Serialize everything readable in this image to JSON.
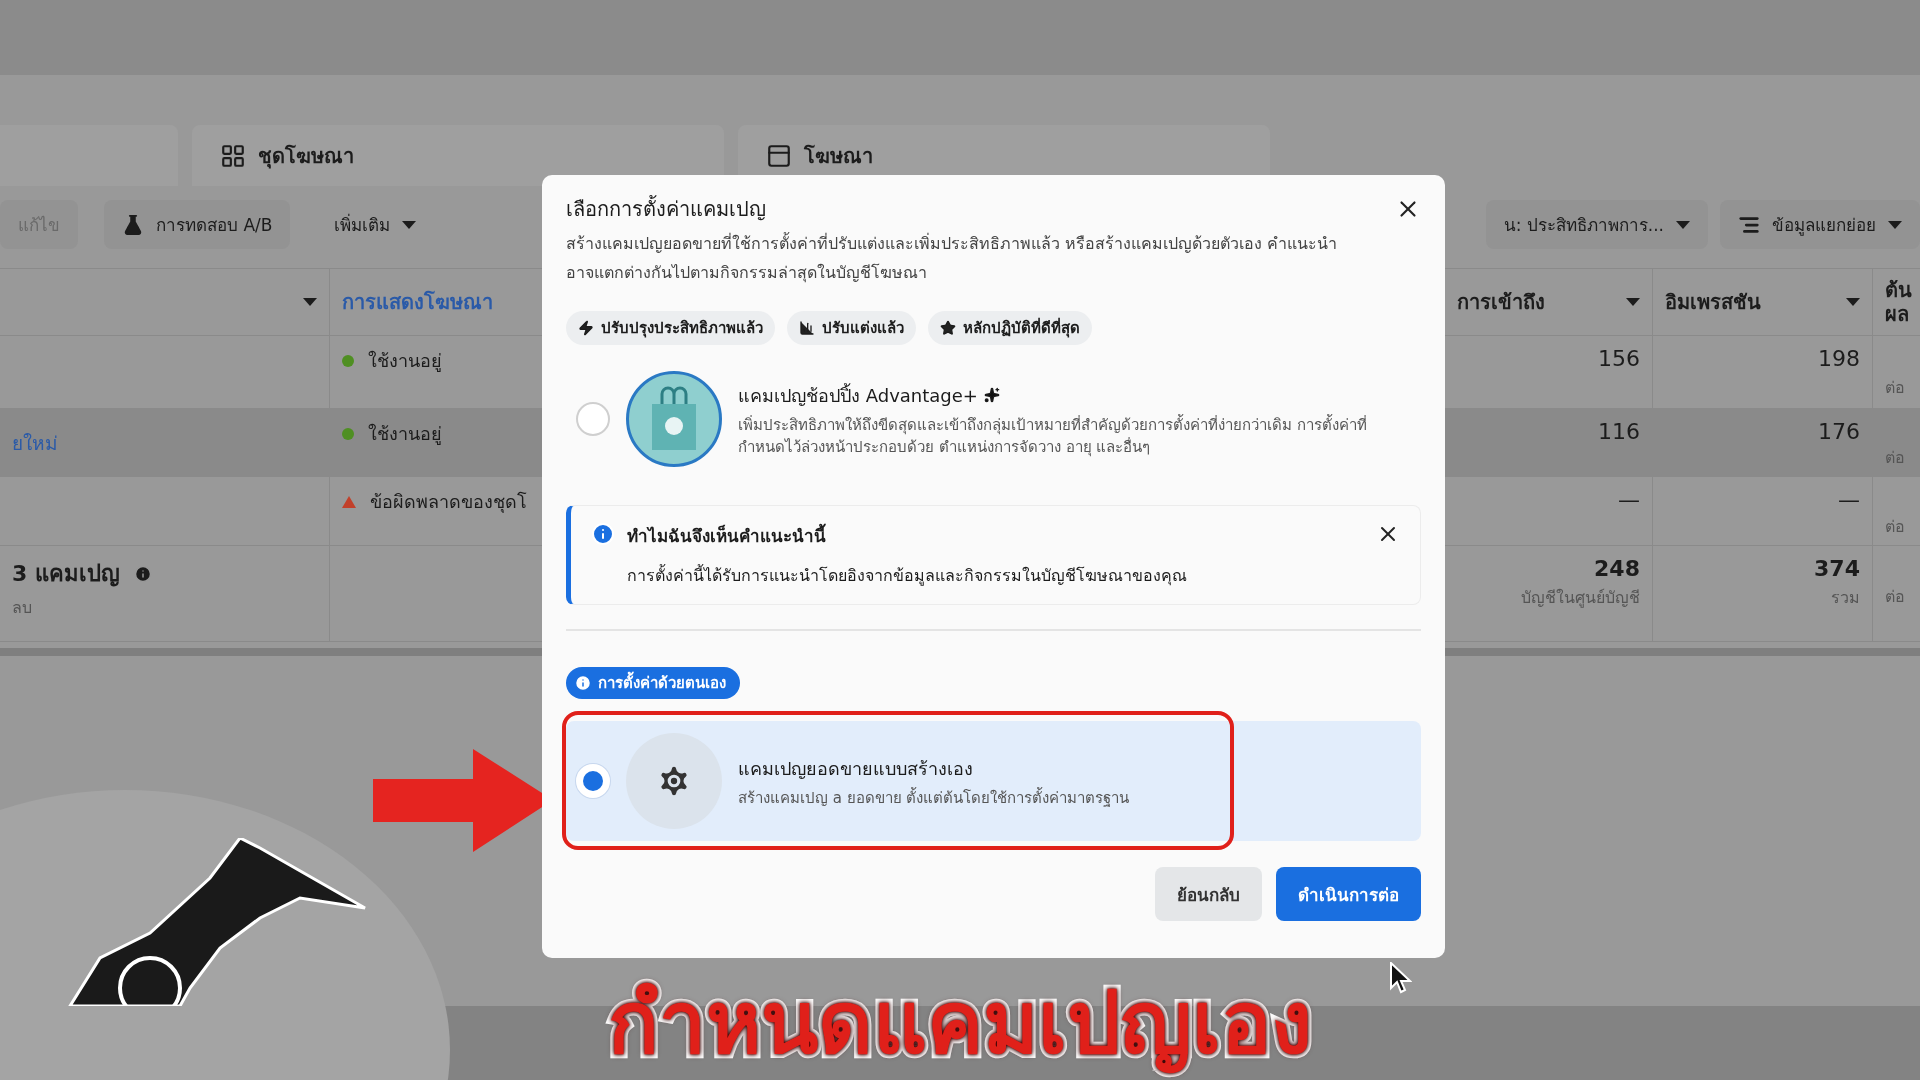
{
  "tabs": [
    {
      "label": "ชุดโฆษณา",
      "kind": "grid"
    },
    {
      "label": "โฆษณา",
      "kind": "panel"
    }
  ],
  "toolbar": {
    "left": [
      {
        "label": "แก้ไข",
        "kind": "button",
        "disabled": true
      },
      {
        "label": "การทดสอบ A/B",
        "kind": "flask",
        "disabled": false
      },
      {
        "label": "เพิ่มเติม",
        "kind": "dropdown",
        "disabled": false
      }
    ],
    "right": [
      {
        "label": "น: ประสิทธิภาพการ...",
        "kind": "dropdown",
        "disabled": false
      },
      {
        "label": "ข้อมูลแยกย่อย",
        "kind": "breakdown",
        "disabled": false
      }
    ]
  },
  "table": {
    "columns": [
      {
        "label": "การแสดงโฆษณา",
        "selected": true
      },
      {
        "label": "การเข้าถึง",
        "selected": false
      },
      {
        "label": "อิมเพรสชัน",
        "selected": false
      },
      {
        "label": "ต้น ผล",
        "selected": false
      }
    ],
    "rows": [
      {
        "status": {
          "kind": "active",
          "text": "ใช้งานอยู่"
        },
        "reach": "156",
        "impressions": "198",
        "column_5": "ต่อ",
        "selected": false
      },
      {
        "column_1": "ยใหม่",
        "status": {
          "kind": "active",
          "text": "ใช้งานอยู่"
        },
        "reach": "116",
        "impressions": "176",
        "column_5": "ต่อ",
        "selected": true
      },
      {
        "status": {
          "kind": "error",
          "text": "ข้อผิดพลาดของชุดโ"
        },
        "reach": "—",
        "impressions": "—",
        "column_5": "ต่อ",
        "selected": false
      }
    ],
    "summary": {
      "title": "3 แคมเปญ",
      "subtitle": "ลบ",
      "reach": "248",
      "reach_note": "บัญชีในศูนย์บัญชี",
      "impressions": "374",
      "impressions_note": "รวม",
      "column_5": "ต่อ"
    }
  },
  "dialog": {
    "title": "เลือกการตั้งค่าแคมเปญ",
    "description": "สร้างแคมเปญยอดขายที่ใช้การตั้งค่าที่ปรับแต่งและเพิ่มประสิทธิภาพแล้ว หรือสร้างแคมเปญด้วยตัวเอง คำแนะนำอาจแตกต่างกันไปตามกิจกรรมล่าสุดในบัญชีโฆษณา",
    "chips": [
      {
        "label": "ปรับปรุงประสิทธิภาพแล้ว",
        "kind": "bolt"
      },
      {
        "label": "ปรับแต่งแล้ว",
        "kind": "bars"
      },
      {
        "label": "หลักปฏิบัติที่ดีที่สุด",
        "kind": "star"
      }
    ],
    "recommended": {
      "kind": "shopping-bag",
      "title": "แคมเปญช้อปปิ้ง Advantage+",
      "description": "เพิ่มประสิทธิภาพให้ถึงขีดสุดและเข้าถึงกลุ่มเป้าหมายที่สำคัญด้วยการตั้งค่าที่ง่ายกว่าเดิม การตั้งค่าที่กำหนดไว้ล่วงหน้าประกอบด้วย ตำแหน่งการจัดวาง อายุ และอื่นๆ",
      "selected": false
    },
    "notice": {
      "title": "ทำไมฉันจึงเห็นคำแนะนำนี้",
      "body": "การตั้งค่านี้ได้รับการแนะนำโดยอิงจากข้อมูลและกิจกรรมในบัญชีโฆษณาของคุณ"
    },
    "manual_badge": "การตั้งค่าด้วยตนเอง",
    "manual": {
      "kind": "gear",
      "title": "แคมเปญยอดขายแบบสร้างเอง",
      "description": "สร้างแคมเปญ a ยอดขาย ตั้งแต่ต้นโดยใช้การตั้งค่ามาตรฐาน",
      "selected": true
    },
    "buttons": [
      {
        "label": "ย้อนกลับ",
        "kind": "secondary"
      },
      {
        "label": "ดำเนินการต่อ",
        "kind": "primary"
      }
    ]
  },
  "caption": "กำหนดแคมเปญเอง"
}
